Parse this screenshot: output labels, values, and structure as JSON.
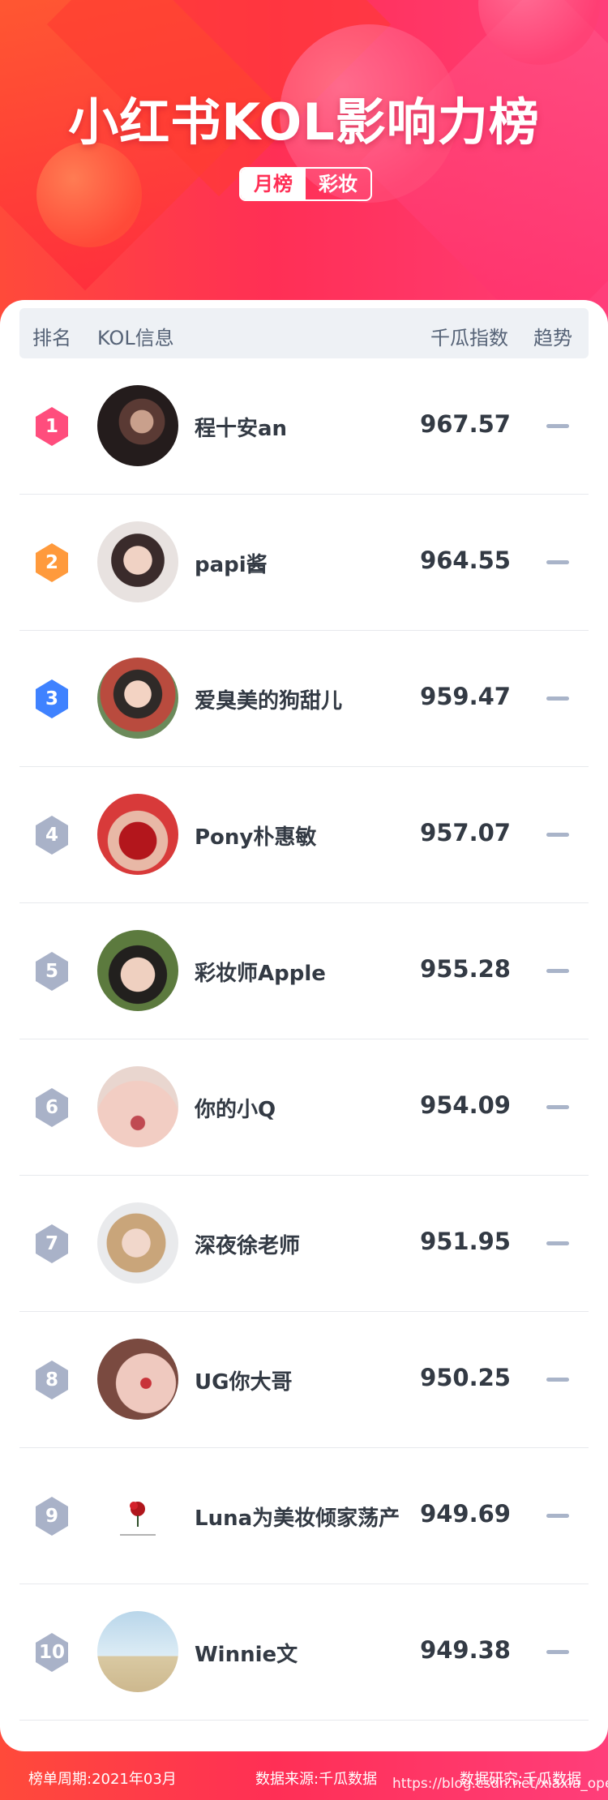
{
  "header": {
    "title": "小红书KOL影响力榜",
    "tabs": [
      {
        "label": "月榜",
        "active": true
      },
      {
        "label": "彩妆",
        "active": false
      }
    ]
  },
  "table": {
    "columns": {
      "rank": "排名",
      "info": "KOL信息",
      "index": "千瓜指数",
      "trend": "趋势"
    },
    "rows": [
      {
        "rank": "1",
        "name": "程十安an",
        "score": "967.57",
        "badge_color": "#ff4d7d",
        "trend": "flat"
      },
      {
        "rank": "2",
        "name": "papi酱",
        "score": "964.55",
        "badge_color": "#ff9a3c",
        "trend": "flat"
      },
      {
        "rank": "3",
        "name": "爱臭美的狗甜儿",
        "score": "959.47",
        "badge_color": "#3f82ff",
        "trend": "flat"
      },
      {
        "rank": "4",
        "name": "Pony朴惠敏",
        "score": "957.07",
        "badge_color": "#a9b2c8",
        "trend": "flat"
      },
      {
        "rank": "5",
        "name": "彩妆师Apple",
        "score": "955.28",
        "badge_color": "#a9b2c8",
        "trend": "flat"
      },
      {
        "rank": "6",
        "name": "你的小Q",
        "score": "954.09",
        "badge_color": "#a9b2c8",
        "trend": "flat"
      },
      {
        "rank": "7",
        "name": "深夜徐老师",
        "score": "951.95",
        "badge_color": "#a9b2c8",
        "trend": "flat"
      },
      {
        "rank": "8",
        "name": "UG你大哥",
        "score": "950.25",
        "badge_color": "#a9b2c8",
        "trend": "flat"
      },
      {
        "rank": "9",
        "name": "Luna为美妆倾家荡产",
        "score": "949.69",
        "badge_color": "#a9b2c8",
        "trend": "flat"
      },
      {
        "rank": "10",
        "name": "Winnie文",
        "score": "949.38",
        "badge_color": "#a9b2c8",
        "trend": "flat"
      }
    ]
  },
  "footer": {
    "period": "榜单周期:2021年03月",
    "source": "数据来源:千瓜数据",
    "research": "数据研究:千瓜数据",
    "watermark": "https://blog.csdn.net/xiaxia_operator"
  },
  "colors": {
    "brand": "#ff2f55",
    "trend_flat": "#a9b4c9",
    "text": "#333a44"
  },
  "icons": {
    "trend_flat": "minus-icon",
    "rank_badge": "hexagon-icon"
  }
}
